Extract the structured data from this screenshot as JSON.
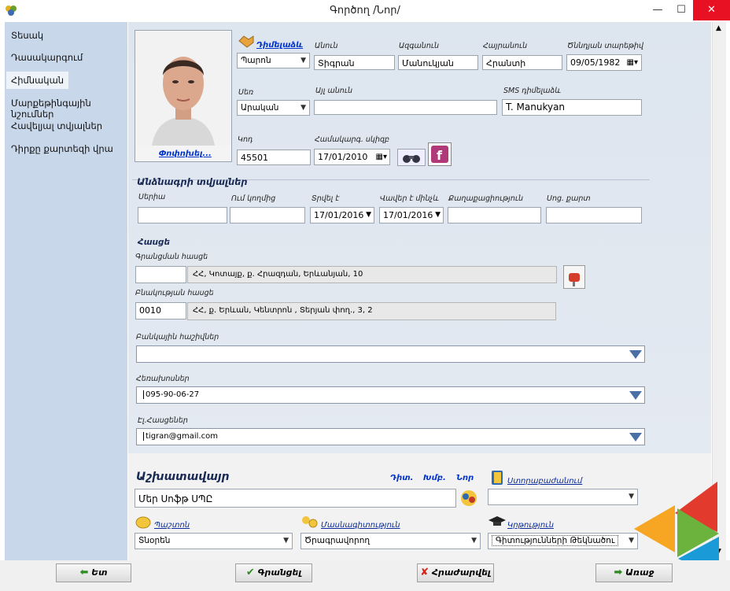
{
  "window": {
    "title": "Գործող /Նոր/",
    "minimize": "—",
    "maximize": "☐",
    "close": "✕"
  },
  "sidebar": {
    "items": [
      {
        "label": "Տեսակ"
      },
      {
        "label": "Դասակարգում"
      },
      {
        "label": "Հիմնական"
      },
      {
        "label": "Մարքեթինգային նշումներ"
      },
      {
        "label": "Հավելյալ տվյալներ"
      },
      {
        "label": "Դիրքը քարտեզի վրա"
      }
    ],
    "selected": "Հիմնական"
  },
  "photo": {
    "change_link": "Փոփոխել..."
  },
  "main": {
    "address_label": "Դիմելաձև",
    "address_value": "Պարոն",
    "first_name_label": "Անուն",
    "first_name_value": "Տիգրան",
    "last_name_label": "Ազգանուն",
    "last_name_value": "Մանուկյան",
    "patronymic_label": "Հայրանուն",
    "patronymic_value": "Հրանտի",
    "birth_label": "Ծննդյան տարեթիվ",
    "birth_value": "09/05/1982",
    "gender_label": "Սեռ",
    "gender_value": "Արական",
    "other_name_label": "Այլ անուն",
    "other_name_value": "",
    "sms_label": "SMS դիմելաձև",
    "sms_value": "T. Manukyan",
    "code_label": "Կոդ",
    "code_value": "45501",
    "system_date_label": "Համակարգ. սկիզբ",
    "system_date_value": "17/01/2010"
  },
  "passport": {
    "title": "Անձնագրի տվյալներ",
    "series_label": "Սերիա",
    "issued_by_label": "Ում կողմից",
    "issued_label": "Տրվել է",
    "valid_label": "Վավեր է մինչև",
    "citizenship_label": "Քաղաքացիություն",
    "social_label": "Սոց. քարտ",
    "series_value": "",
    "issued_by_value": "",
    "issued_value": "17/01/2016",
    "valid_value": "17/01/2016",
    "citizenship_value": "",
    "social_value": ""
  },
  "address": {
    "title": "Հասցե",
    "reg_label": "Գրանցման հասցե",
    "reg_code": "",
    "reg_value": "ՀՀ, Կոտայք, ք. Հրազդան, Երևանյան, 10",
    "live_label": "Բնակության հասցե",
    "live_code": "0010",
    "live_value": "ՀՀ, ք. Երևան, Կենտրոն , Տերյան փող., 3, 2"
  },
  "bank": {
    "label": "Բանկային հաշիվներ",
    "value": ""
  },
  "phones": {
    "label": "Հեռախոսներ",
    "value": "095-90-06-27"
  },
  "emails": {
    "label": "Էլ.Հասցեներ",
    "value": "tigran@gmail.com"
  },
  "work": {
    "title": "Աշխատավայր",
    "link_open": "Դիտ.",
    "link_edit": "Խմբ.",
    "link_new": "Նոր",
    "workplace_value": "Մեր Սոֆթ ՍՊԸ",
    "division_label": "Ստորաբաժանում",
    "division_value": "",
    "position_label": "Պաշտոն",
    "position_value": "Տնօրեն",
    "specialty_label": "Մասնագիտություն",
    "specialty_value": "Ծրագրավորող",
    "education_label": "Կրթություն",
    "education_value": "Գիտությունների Թեկնածու"
  },
  "buttons": {
    "back": "Ետ",
    "save": "Գրանցել",
    "cancel": "Հրաժարվել",
    "forward": "Առաջ"
  },
  "colors": {
    "sidebar": "#c9d7ea",
    "accent_link": "#0033cc",
    "close": "#e81123"
  }
}
